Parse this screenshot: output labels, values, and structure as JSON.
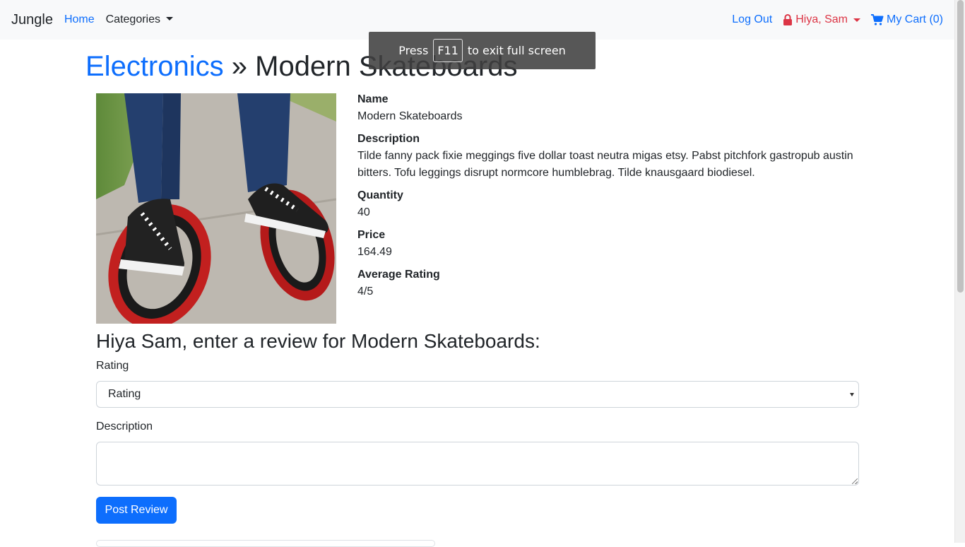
{
  "navbar": {
    "brand": "Jungle",
    "home": "Home",
    "categories": "Categories",
    "logout": "Log Out",
    "user": "Hiya, Sam",
    "cart": "My Cart (0)"
  },
  "toast": {
    "before": "Press",
    "key": "F11",
    "after": "to exit full screen"
  },
  "page": {
    "category": "Electronics",
    "separator": "»",
    "product_name": "Modern Skateboards"
  },
  "product": {
    "image_icon": "skateboard-photo",
    "fields": [
      {
        "label": "Name",
        "value": "Modern Skateboards"
      },
      {
        "label": "Description",
        "value": "Tilde fanny pack fixie meggings five dollar toast neutra migas etsy. Pabst pitchfork gastropub austin bitters. Tofu leggings disrupt normcore humblebrag. Tilde knausgaard biodiesel."
      },
      {
        "label": "Quantity",
        "value": "40"
      },
      {
        "label": "Price",
        "value": "164.49"
      },
      {
        "label": "Average Rating",
        "value": "4/5"
      }
    ]
  },
  "review_form": {
    "heading": "Hiya Sam, enter a review for Modern Skateboards:",
    "rating_label": "Rating",
    "rating_selected": "Rating",
    "description_label": "Description",
    "description_value": "",
    "submit_label": "Post Review"
  },
  "colors": {
    "link": "#0d6efd",
    "user": "#dc3545",
    "navbar_bg": "#f8f9fa",
    "button": "#0d6efd"
  }
}
